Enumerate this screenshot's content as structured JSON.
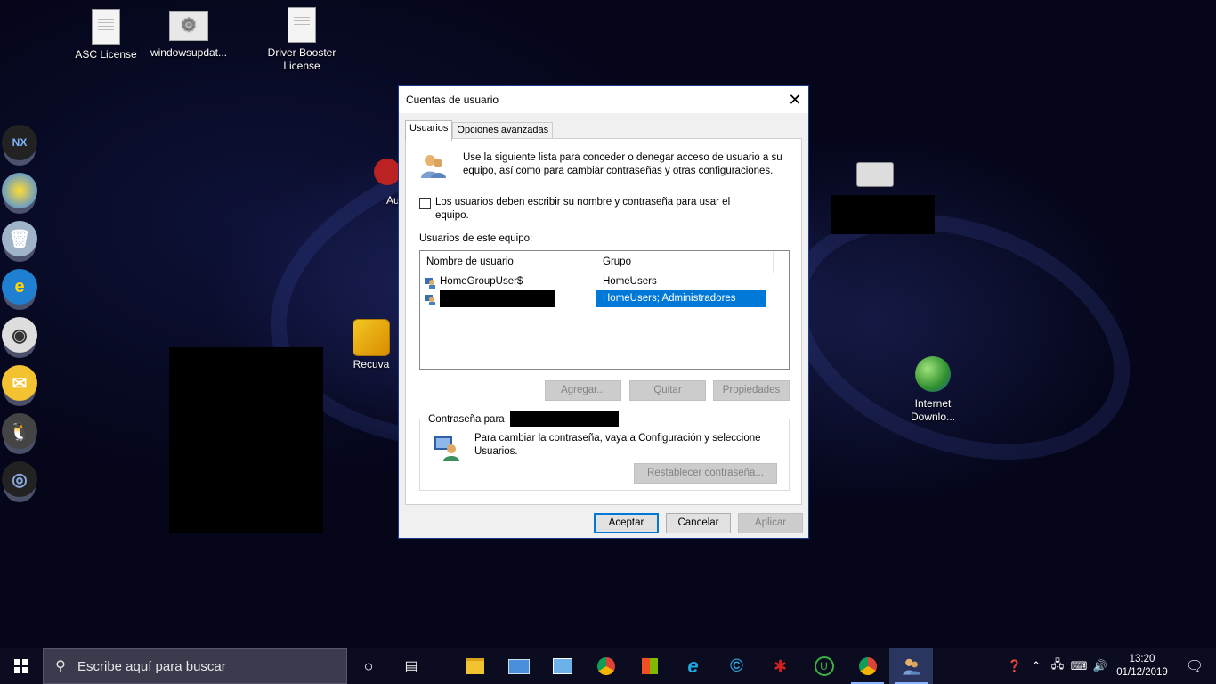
{
  "desktop": {
    "icons_top": [
      {
        "label": "ASC License"
      },
      {
        "label": "windowsupdat..."
      },
      {
        "label": "Driver Booster License"
      }
    ],
    "icons_right": [
      {
        "label": "Internet Downlo..."
      }
    ],
    "icons_middle": [
      {
        "label": "Recuva"
      },
      {
        "label": "Au"
      }
    ]
  },
  "dialog": {
    "title": "Cuentas de usuario",
    "tabs": [
      {
        "label": "Usuarios",
        "active": true
      },
      {
        "label": "Opciones avanzadas",
        "active": false
      }
    ],
    "info_text": "Use la siguiente lista para conceder o denegar acceso de usuario a su equipo, así como para cambiar contraseñas y otras configuraciones.",
    "checkbox": {
      "label": "Los usuarios deben escribir su nombre y contraseña para usar el equipo.",
      "checked": false
    },
    "list_label": "Usuarios de este equipo:",
    "columns": [
      "Nombre de usuario",
      "Grupo"
    ],
    "rows": [
      {
        "name": "HomeGroupUser$",
        "group": "HomeUsers",
        "selected": false
      },
      {
        "name": "",
        "group": "HomeUsers; Administradores",
        "selected": true
      }
    ],
    "buttons": {
      "add": "Agregar...",
      "remove": "Quitar",
      "properties": "Propiedades"
    },
    "password_group": {
      "label": "Contraseña para",
      "text": "Para cambiar la contraseña, vaya a Configuración y seleccione Usuarios.",
      "reset_button": "Restablecer contraseña..."
    },
    "footer": {
      "ok": "Aceptar",
      "cancel": "Cancelar",
      "apply": "Aplicar"
    }
  },
  "taskbar": {
    "search_placeholder": "Escribe aquí para buscar",
    "apps": [
      "file-explorer",
      "remote-desktop",
      "control-panel",
      "chrome",
      "store",
      "internet-explorer",
      "ccleaner",
      "antivirus",
      "uninstaller",
      "chrome-profile",
      "user-accounts"
    ],
    "clock_time": "13:20",
    "clock_date": "01/12/2019"
  },
  "colors": {
    "selection": "#0078d7",
    "dialog_border": "#1c3a8a",
    "taskbar": "#0b0c20"
  }
}
